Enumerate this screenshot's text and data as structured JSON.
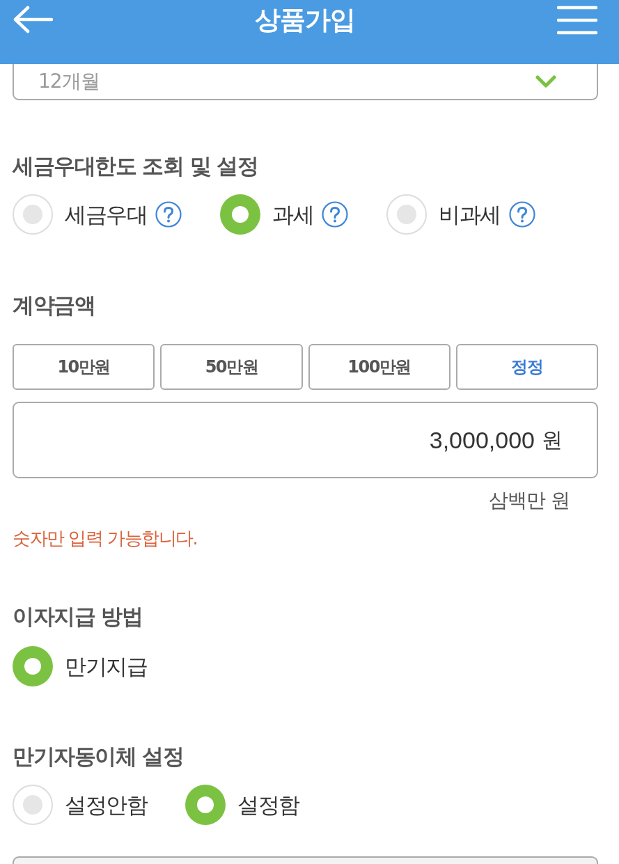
{
  "header": {
    "title": "상품가입"
  },
  "term_select": {
    "value": "12개월"
  },
  "tax_section": {
    "title": "세금우대한도 조회 및 설정",
    "options": [
      {
        "label": "세금우대",
        "selected": false,
        "help": true
      },
      {
        "label": "과세",
        "selected": true,
        "help": true
      },
      {
        "label": "비과세",
        "selected": false,
        "help": true
      }
    ]
  },
  "amount_section": {
    "title": "계약금액",
    "presets": [
      {
        "label": "10만원",
        "kind": "preset"
      },
      {
        "label": "50만원",
        "kind": "preset"
      },
      {
        "label": "100만원",
        "kind": "preset"
      },
      {
        "label": "정정",
        "kind": "correct"
      }
    ],
    "amount": {
      "value": "3,000,000",
      "unit": "원"
    },
    "amount_in_words": "삼백만 원",
    "error": "숫자만 입력 가능합니다."
  },
  "interest_section": {
    "title": "이자지급 방법",
    "options": [
      {
        "label": "만기지급",
        "selected": true
      }
    ]
  },
  "transfer_section": {
    "title": "만기자동이체 설정",
    "options": [
      {
        "label": "설정안함",
        "selected": false
      },
      {
        "label": "설정함",
        "selected": true
      }
    ]
  }
}
